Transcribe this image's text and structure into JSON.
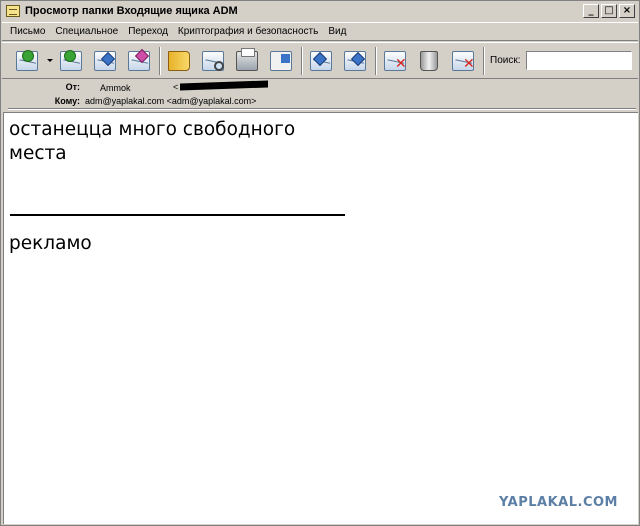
{
  "window": {
    "title": "Просмотр папки Входящие ящика ADM",
    "buttons": {
      "minimize": "_",
      "maximize": "□",
      "close": "×"
    }
  },
  "menu": {
    "items": [
      "Письмо",
      "Специальное",
      "Переход",
      "Криптография и безопасность",
      "Вид"
    ]
  },
  "toolbar": {
    "icons": [
      "get-mail-icon",
      "forward-group-icon",
      "reply-icon",
      "new-message-icon",
      "address-book-icon",
      "find-icon",
      "print-icon",
      "view-icon",
      "reply-all-icon",
      "forward-icon",
      "delete-icon",
      "trash-icon",
      "junk-icon"
    ],
    "search_label": "Поиск:",
    "search_value": ""
  },
  "headers": {
    "from_label": "От:",
    "from_name": "Ammok",
    "from_addr_open": "<",
    "to_label": "Кому:",
    "to_value": "adm@yaplakal.com <adm@yaplakal.com>"
  },
  "message": {
    "line1": "останецца много свободного",
    "line2": "места",
    "line3": "рекламо"
  },
  "watermark": "YAPLAKAL.COM"
}
